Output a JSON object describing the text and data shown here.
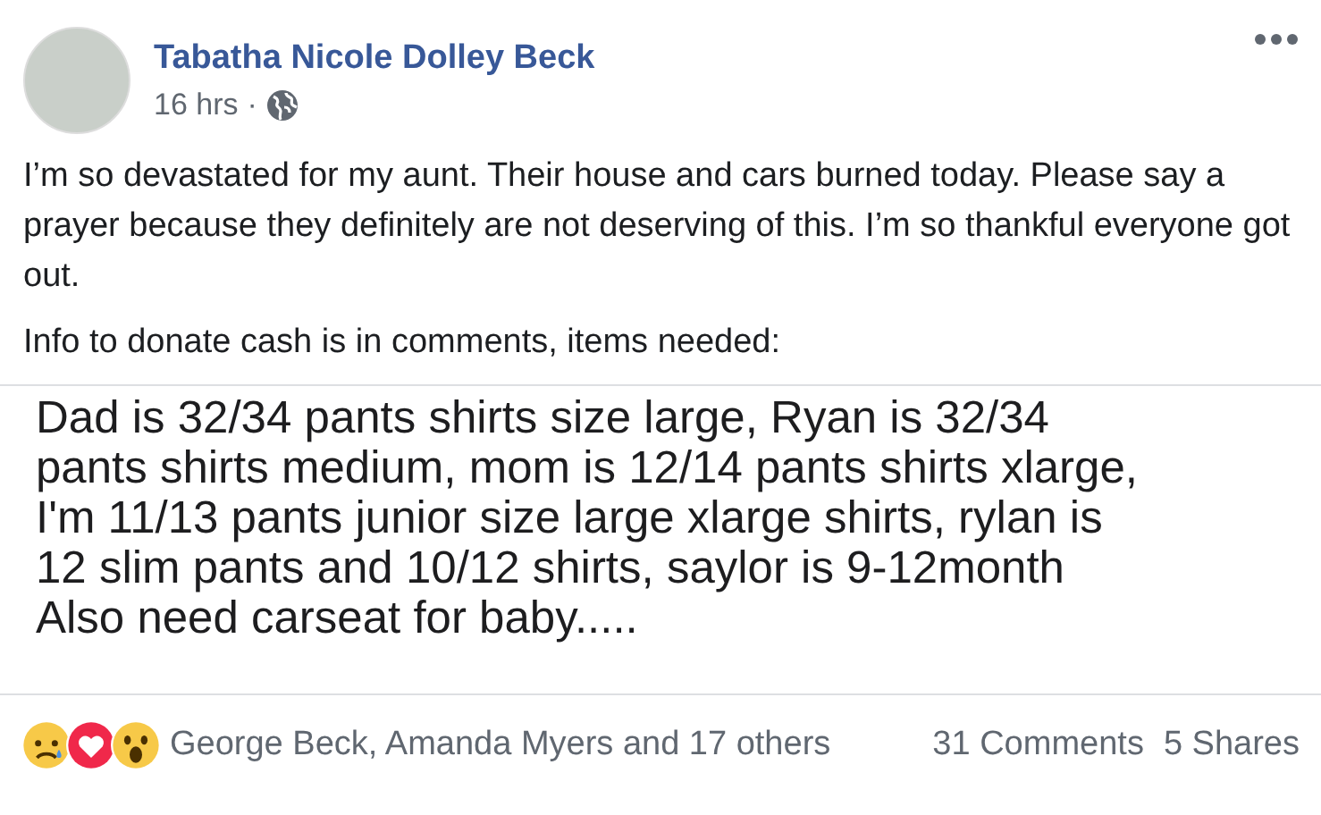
{
  "post": {
    "author": "Tabatha Nicole Dolley Beck",
    "time": "16 hrs",
    "separator": "·",
    "paragraphs": [
      "I’m so devastated for my aunt. Their house and cars burned today. Please say a prayer because they definitely are not deserving of this. I’m so thankful everyone got out.",
      "Info to donate cash is in comments, items needed:"
    ]
  },
  "shared_image": {
    "lines": [
      "Dad is 32/34 pants shirts size large, Ryan is 32/34",
      "pants shirts medium, mom is 12/14 pants shirts xlarge,",
      "I'm 11/13 pants junior size large xlarge shirts, rylan is",
      "12 slim pants and 10/12 shirts, saylor is 9-12month",
      "Also need carseat for baby....."
    ]
  },
  "footer": {
    "reactions": [
      {
        "kind": "sad"
      },
      {
        "kind": "love"
      },
      {
        "kind": "wow"
      }
    ],
    "reactors": "George Beck, Amanda Myers and 17 others",
    "comments": "31 Comments",
    "shares": "5 Shares"
  }
}
